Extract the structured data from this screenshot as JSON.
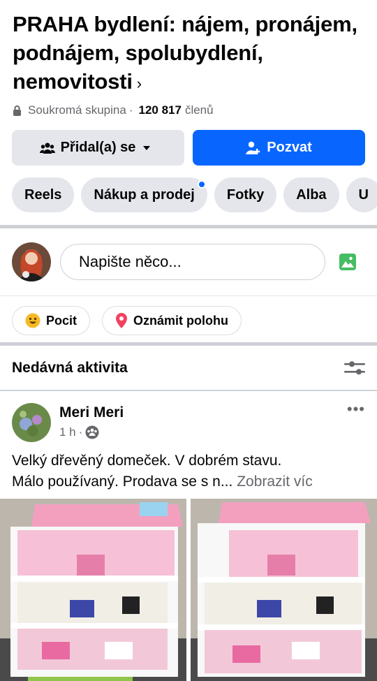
{
  "group": {
    "title": "PRAHA bydlení: nájem, pronájem, podnájem, spolubydlení, nemovitosti",
    "privacy": "Soukromá skupina",
    "separator": "·",
    "member_count": "120 817",
    "members_label": "členů"
  },
  "actions": {
    "joined_label": "Přidal(a) se",
    "invite_label": "Pozvat"
  },
  "tabs": [
    {
      "label": "Reels"
    },
    {
      "label": "Nákup a prodej"
    },
    {
      "label": "Fotky"
    },
    {
      "label": "Alba"
    },
    {
      "label": "U"
    }
  ],
  "composer": {
    "placeholder": "Napište něco..."
  },
  "quick_actions": {
    "feeling_label": "Pocit",
    "location_label": "Oznámit polohu"
  },
  "feed": {
    "section_title": "Nedávná aktivita"
  },
  "post": {
    "author": "Meri Meri",
    "time": "1 h",
    "time_separator": "·",
    "text_line1": "Velký dřevěný domeček. V dobrém stavu.",
    "text_line2": "Málo používaný. Prodava se s n...",
    "see_more": "Zobrazit víc",
    "more_menu": "•••"
  },
  "colors": {
    "accent": "#0866ff",
    "button_gray": "#e4e6eb",
    "secondary_text": "#65676b"
  },
  "icons": {
    "privacy": "lock-icon",
    "joined": "group-icon",
    "invite": "add-person-icon",
    "photo": "photo-icon",
    "feeling": "smiley-icon",
    "location": "location-pin-icon",
    "filter": "filter-sliders-icon",
    "audience": "public-group-icon"
  }
}
